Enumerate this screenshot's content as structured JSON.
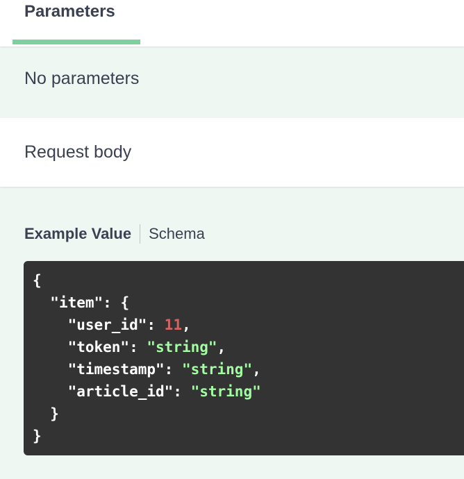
{
  "parameters": {
    "tab_label": "Parameters",
    "empty_text": "No parameters"
  },
  "request_body": {
    "title": "Request body"
  },
  "example_tabs": {
    "active_label": "Example Value",
    "inactive_label": "Schema"
  },
  "example_json": {
    "open_brace": "{",
    "item_key": "\"item\"",
    "item_open": ": {",
    "user_id_key": "\"user_id\"",
    "user_id_value": "11",
    "token_key": "\"token\"",
    "token_value": "\"string\"",
    "timestamp_key": "\"timestamp\"",
    "timestamp_value": "\"string\"",
    "article_id_key": "\"article_id\"",
    "article_id_value": "\"string\"",
    "inner_close": "}",
    "outer_close": "}"
  },
  "colors": {
    "tab_underline": "#7dd19f",
    "background": "#eff7f3",
    "code_background": "#333333",
    "number_value": "#d36363",
    "string_value": "#a2fca2"
  }
}
